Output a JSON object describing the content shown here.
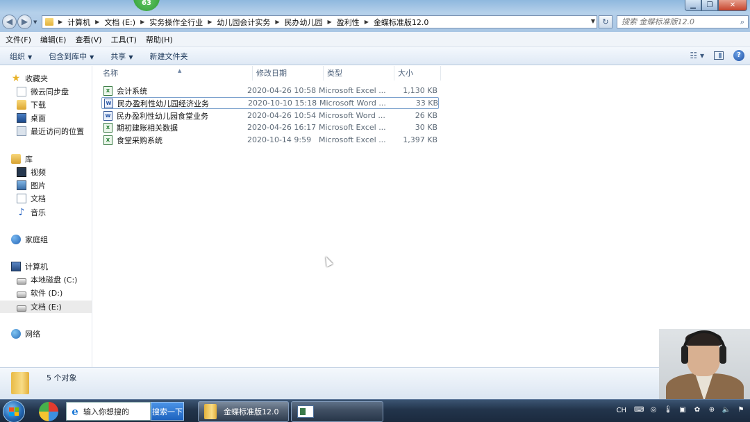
{
  "window": {
    "badge": "63",
    "controls": {
      "minimize": "▁",
      "maximize": "❐",
      "close": "✕"
    }
  },
  "address": {
    "breadcrumbs": [
      "计算机",
      "文档 (E:)",
      "实务操作全行业",
      "幼儿园会计实务",
      "民办幼儿园",
      "盈利性",
      "金蝶标准版12.0"
    ],
    "search_placeholder": "搜索 金蝶标准版12.0"
  },
  "menu": {
    "items": [
      "文件(F)",
      "编辑(E)",
      "查看(V)",
      "工具(T)",
      "帮助(H)"
    ]
  },
  "toolbar": {
    "organize": "组织",
    "include_library": "包含到库中",
    "share": "共享",
    "new_folder": "新建文件夹"
  },
  "sidebar": {
    "favorites": "收藏夹",
    "weiyun": "微云同步盘",
    "downloads": "下载",
    "desktop": "桌面",
    "recent": "最近访问的位置",
    "libraries": "库",
    "videos": "视频",
    "pictures": "图片",
    "documents": "文档",
    "music": "音乐",
    "homegroup": "家庭组",
    "computer": "计算机",
    "drive_c": "本地磁盘 (C:)",
    "drive_d": "软件 (D:)",
    "drive_e": "文档 (E:)",
    "network": "网络"
  },
  "columns": {
    "name": "名称",
    "date": "修改日期",
    "type": "类型",
    "size": "大小"
  },
  "files": [
    {
      "name": "会计系统",
      "date": "2020-04-26 10:58",
      "type": "Microsoft Excel ...",
      "size": "1,130 KB",
      "kind": "excel"
    },
    {
      "name": "民办盈利性幼儿园经济业务",
      "date": "2020-10-10 15:18",
      "type": "Microsoft Word ...",
      "size": "33 KB",
      "kind": "word"
    },
    {
      "name": "民办盈利性幼儿园食堂业务",
      "date": "2020-04-26 10:54",
      "type": "Microsoft Word ...",
      "size": "26 KB",
      "kind": "word"
    },
    {
      "name": "期初建账相关数据",
      "date": "2020-04-26 16:17",
      "type": "Microsoft Excel ...",
      "size": "30 KB",
      "kind": "excel"
    },
    {
      "name": "食堂采购系统",
      "date": "2020-10-14 9:59",
      "type": "Microsoft Excel ...",
      "size": "1,397 KB",
      "kind": "excel"
    }
  ],
  "status": {
    "count_text": "5 个对象"
  },
  "taskbar": {
    "search_value": "输入你想搜的",
    "search_button": "搜索一下",
    "explorer_label": "金蝶标准版12.0",
    "tray_lang": "CH"
  }
}
